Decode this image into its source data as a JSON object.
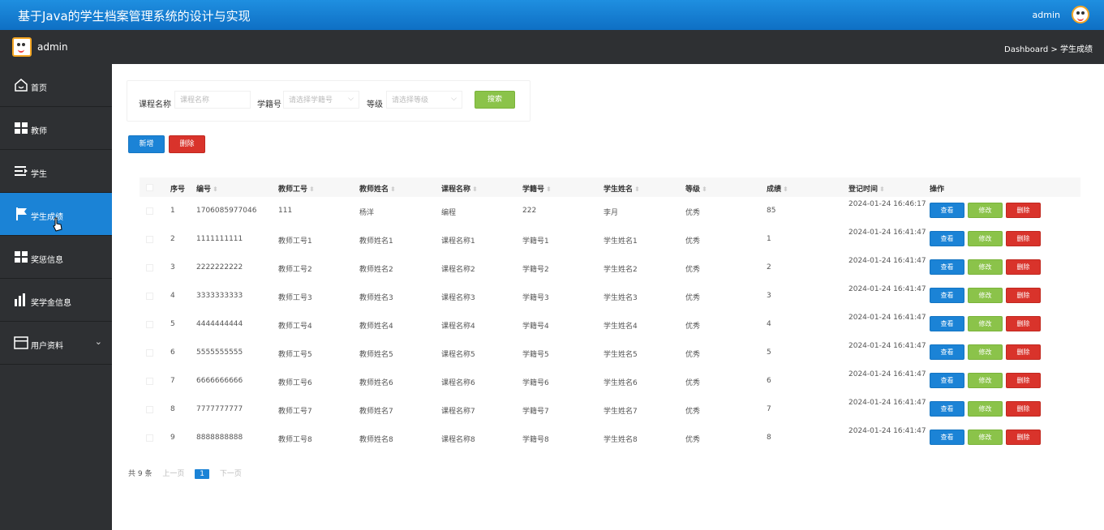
{
  "header": {
    "title": "基于Java的学生档案管理系统的设计与实现",
    "user": "admin"
  },
  "subbar": {
    "user": "admin",
    "breadcrumb": "Dashboard > 学生成绩"
  },
  "sidebar": {
    "items": [
      {
        "label": "首页",
        "icon": "home-icon",
        "active": false
      },
      {
        "label": "教师",
        "icon": "grid-icon",
        "active": false
      },
      {
        "label": "学生",
        "icon": "list-icon",
        "active": false
      },
      {
        "label": "学生成绩",
        "icon": "flag-icon",
        "active": true
      },
      {
        "label": "奖惩信息",
        "icon": "grid-icon",
        "active": false
      },
      {
        "label": "奖学金信息",
        "icon": "bar-chart-icon",
        "active": false
      },
      {
        "label": "用户资料",
        "icon": "card-icon",
        "active": false,
        "chevron": "⌄"
      }
    ]
  },
  "search": {
    "course_label": "课程名称",
    "course_placeholder": "课程名称",
    "student_label": "学籍号",
    "student_placeholder": "请选择学籍号",
    "grade_label": "等级",
    "grade_placeholder": "请选择等级",
    "search_button": "搜索"
  },
  "toolbar": {
    "add_button": "新增",
    "delete_button": "删除"
  },
  "table": {
    "columns": [
      "序号",
      "编号",
      "教师工号",
      "教师姓名",
      "课程名称",
      "学籍号",
      "学生姓名",
      "等级",
      "成绩",
      "登记时间",
      "操作"
    ],
    "actions": {
      "view": "查看",
      "edit": "修改",
      "delete": "删除"
    },
    "rows": [
      {
        "idx": "1",
        "code": "1706085977046",
        "teacher_no": "111",
        "teacher_name": "杨洋",
        "course": "编程",
        "student_no": "222",
        "student_name": "李月",
        "level": "优秀",
        "score": "85",
        "time": "2024-01-24 16:46:17"
      },
      {
        "idx": "2",
        "code": "1111111111",
        "teacher_no": "教师工号1",
        "teacher_name": "教师姓名1",
        "course": "课程名称1",
        "student_no": "学籍号1",
        "student_name": "学生姓名1",
        "level": "优秀",
        "score": "1",
        "time": "2024-01-24 16:41:47"
      },
      {
        "idx": "3",
        "code": "2222222222",
        "teacher_no": "教师工号2",
        "teacher_name": "教师姓名2",
        "course": "课程名称2",
        "student_no": "学籍号2",
        "student_name": "学生姓名2",
        "level": "优秀",
        "score": "2",
        "time": "2024-01-24 16:41:47"
      },
      {
        "idx": "4",
        "code": "3333333333",
        "teacher_no": "教师工号3",
        "teacher_name": "教师姓名3",
        "course": "课程名称3",
        "student_no": "学籍号3",
        "student_name": "学生姓名3",
        "level": "优秀",
        "score": "3",
        "time": "2024-01-24 16:41:47"
      },
      {
        "idx": "5",
        "code": "4444444444",
        "teacher_no": "教师工号4",
        "teacher_name": "教师姓名4",
        "course": "课程名称4",
        "student_no": "学籍号4",
        "student_name": "学生姓名4",
        "level": "优秀",
        "score": "4",
        "time": "2024-01-24 16:41:47"
      },
      {
        "idx": "6",
        "code": "5555555555",
        "teacher_no": "教师工号5",
        "teacher_name": "教师姓名5",
        "course": "课程名称5",
        "student_no": "学籍号5",
        "student_name": "学生姓名5",
        "level": "优秀",
        "score": "5",
        "time": "2024-01-24 16:41:47"
      },
      {
        "idx": "7",
        "code": "6666666666",
        "teacher_no": "教师工号6",
        "teacher_name": "教师姓名6",
        "course": "课程名称6",
        "student_no": "学籍号6",
        "student_name": "学生姓名6",
        "level": "优秀",
        "score": "6",
        "time": "2024-01-24 16:41:47"
      },
      {
        "idx": "8",
        "code": "7777777777",
        "teacher_no": "教师工号7",
        "teacher_name": "教师姓名7",
        "course": "课程名称7",
        "student_no": "学籍号7",
        "student_name": "学生姓名7",
        "level": "优秀",
        "score": "7",
        "time": "2024-01-24 16:41:47"
      },
      {
        "idx": "9",
        "code": "8888888888",
        "teacher_no": "教师工号8",
        "teacher_name": "教师姓名8",
        "course": "课程名称8",
        "student_no": "学籍号8",
        "student_name": "学生姓名8",
        "level": "优秀",
        "score": "8",
        "time": "2024-01-24 16:41:47"
      }
    ]
  },
  "pager": {
    "total": "共 9 条",
    "prev": "上一页",
    "current": "1",
    "next": "下一页"
  },
  "colors": {
    "primary": "#1b83d6",
    "success": "#8bc34a",
    "danger": "#d9332b",
    "sidebar": "#2e3033"
  }
}
